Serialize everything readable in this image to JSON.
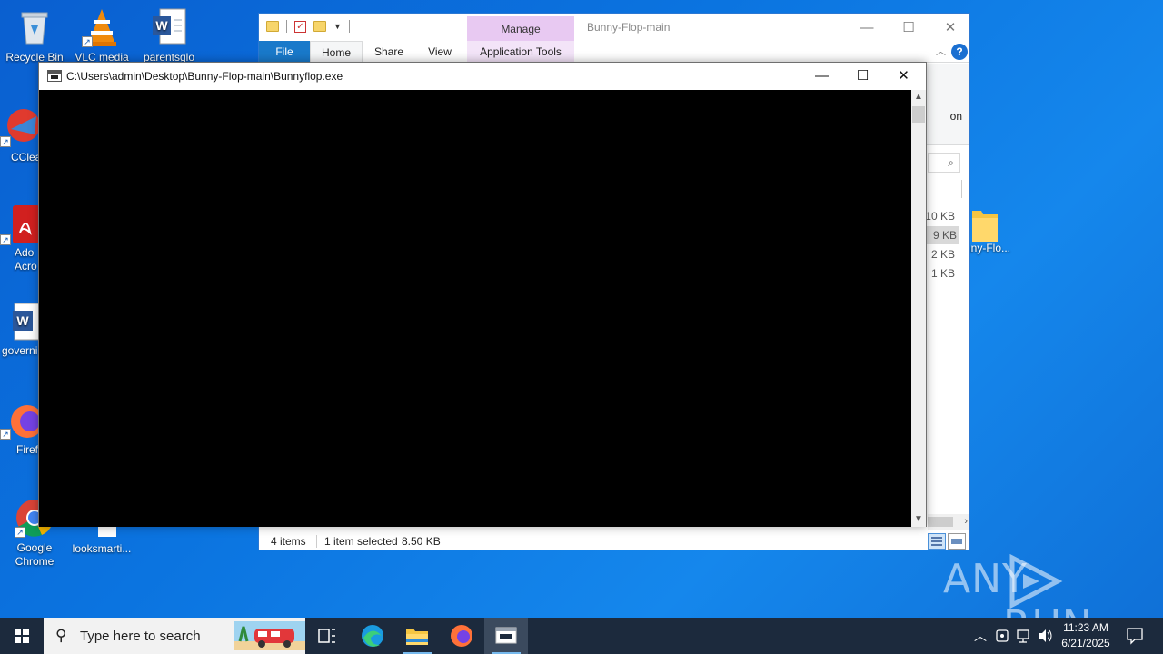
{
  "desktop": {
    "icons": [
      {
        "label": "Recycle Bin"
      },
      {
        "label": "VLC media"
      },
      {
        "label": "parentsglo"
      },
      {
        "label": "CClea"
      },
      {
        "label": "Ado"
      },
      {
        "label": "Acro"
      },
      {
        "label": "governi"
      },
      {
        "label": "Firef"
      },
      {
        "label": "Google"
      },
      {
        "label": "Chrome"
      },
      {
        "label": "looksmarti..."
      },
      {
        "label": "nny-Flo..."
      }
    ]
  },
  "explorer": {
    "manage_tab": "Manage",
    "title": "Bunny-Flop-main",
    "tabs": {
      "file": "File",
      "home": "Home",
      "share": "Share",
      "view": "View",
      "app_tools": "Application Tools"
    },
    "ribbon_partial_text": "on",
    "help": "?",
    "file_sizes": [
      "10 KB",
      "9 KB",
      "2 KB",
      "1 KB"
    ],
    "status": {
      "items": "4 items",
      "selected": "1 item selected",
      "size": "8.50 KB"
    }
  },
  "console": {
    "title": "C:\\Users\\admin\\Desktop\\Bunny-Flop-main\\Bunnyflop.exe"
  },
  "watermark": {
    "left": "ANY",
    "right": "RUN"
  },
  "taskbar": {
    "search_placeholder": "Type here to search",
    "time": "11:23 AM",
    "date": "6/21/2025"
  }
}
